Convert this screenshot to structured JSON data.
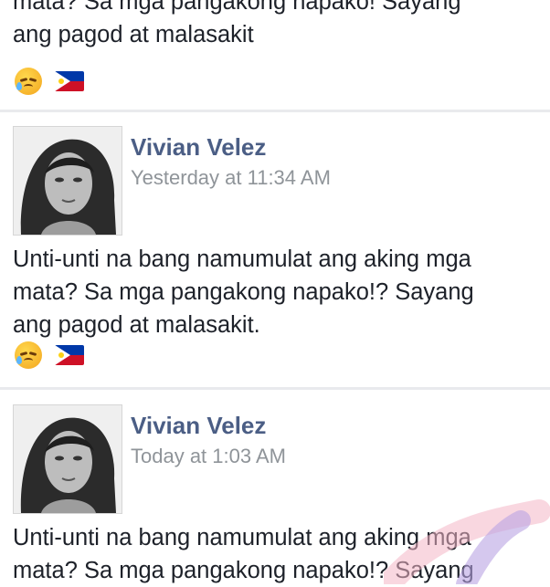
{
  "colors": {
    "author": "#4b5e85",
    "timestamp": "#8f9499",
    "text": "#1d2129",
    "divider": "#e9eaed"
  },
  "partial_post": {
    "text": "mata? Sa mga pangakong napako! Sayang\nang pagod at malasakit",
    "emojis": [
      "crying-face-emoji",
      "philippines-flag-emoji"
    ]
  },
  "posts": [
    {
      "author": "Vivian Velez",
      "timestamp": "Yesterday at 11:34 AM",
      "text": "Unti-unti na bang namumulat ang aking mga\nmata? Sa mga pangakong napako!? Sayang\nang pagod at malasakit.",
      "emojis": [
        "crying-face-emoji",
        "philippines-flag-emoji"
      ]
    },
    {
      "author": "Vivian Velez",
      "timestamp": "Today at 1:03 AM",
      "text": "Unti-unti na bang namumulat ang aking mga\nmata? Sa mga pangakong napako!? Sayang"
    }
  ]
}
